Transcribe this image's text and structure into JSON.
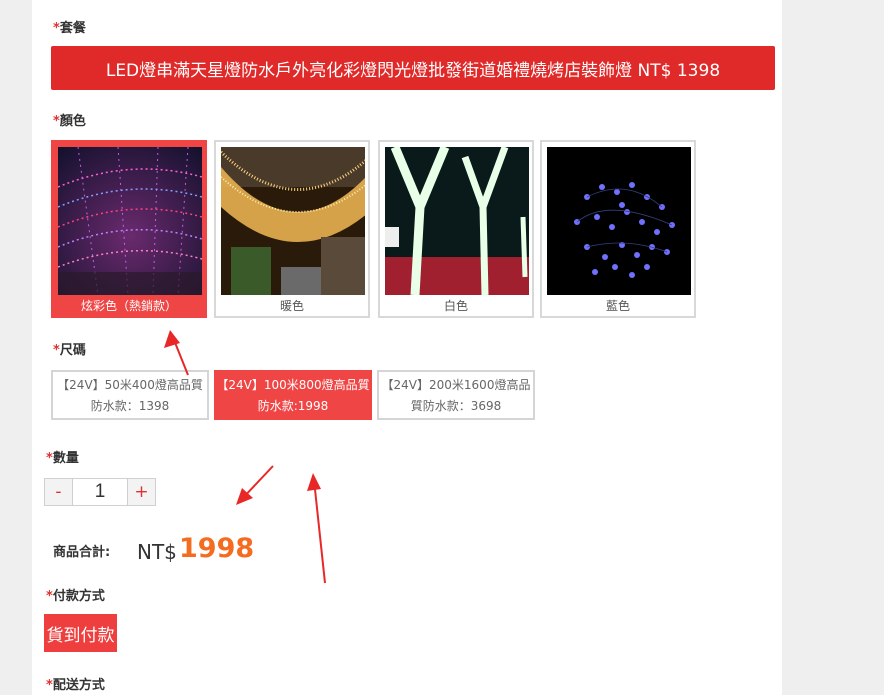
{
  "package": {
    "label": "套餐",
    "option": "LED燈串滿天星燈防水戶外亮化彩燈閃光燈批發街道婚禮燒烤店裝飾燈 NT$ 1398"
  },
  "color": {
    "label": "顏色",
    "options": [
      {
        "name": "炫彩色（熱銷款）",
        "selected": true
      },
      {
        "name": "暖色",
        "selected": false
      },
      {
        "name": "白色",
        "selected": false
      },
      {
        "name": "藍色",
        "selected": false
      }
    ]
  },
  "size": {
    "label": "尺碼",
    "options": [
      {
        "line1": "【24V】50米400燈高品質",
        "line2": "防水款：1398",
        "selected": false
      },
      {
        "line1": "【24V】100米800燈高品質",
        "line2": "防水款:1998",
        "selected": true
      },
      {
        "line1": "【24V】200米1600燈高品",
        "line2": "質防水款：3698",
        "selected": false
      }
    ]
  },
  "quantity": {
    "label": "數量",
    "minus": "-",
    "value": "1",
    "plus": "+"
  },
  "total": {
    "label": "商品合計:",
    "currency": "NT$",
    "amount": "1998"
  },
  "payment": {
    "label": "付款方式",
    "option": "貨到付款"
  },
  "shipping": {
    "label": "配送方式"
  },
  "required_mark": "*",
  "colors": {
    "accent_red": "#e02a2a",
    "selected_red": "#f04545",
    "price_orange": "#f56b20"
  }
}
